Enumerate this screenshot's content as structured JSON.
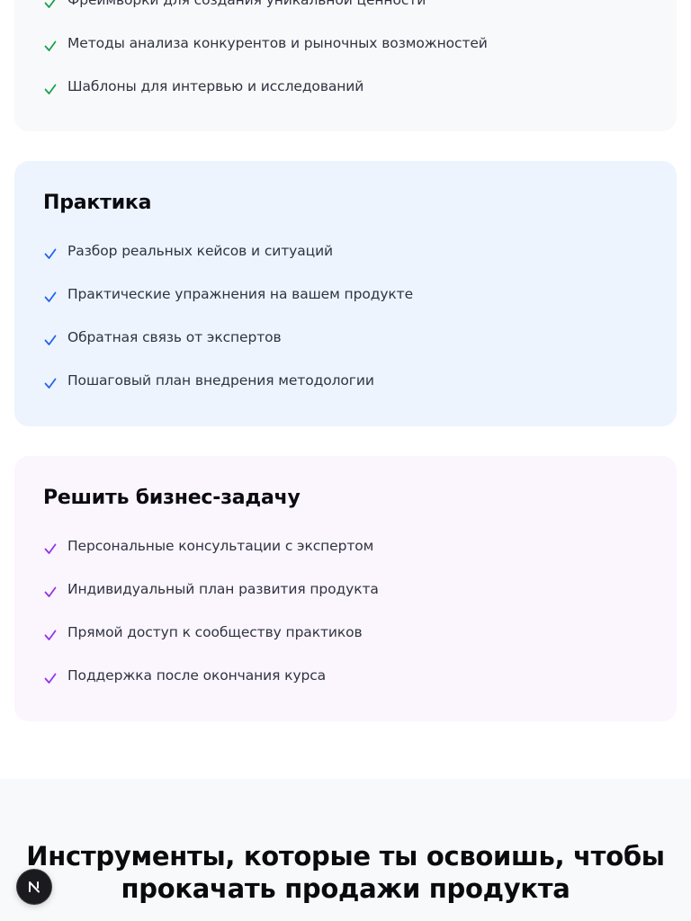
{
  "sections": {
    "top": {
      "items": [
        "Фреймворки для создания уникальной ценности",
        "Методы анализа конкурентов и рыночных возможностей",
        "Шаблоны для интервью и исследований"
      ],
      "check_color": "#16a34a"
    },
    "practice": {
      "title": "Практика",
      "items": [
        "Разбор реальных кейсов и ситуаций",
        "Практические упражнения на вашем продукте",
        "Обратная связь от экспертов",
        "Пошаговый план внедрения методологии"
      ],
      "check_color": "#2563eb"
    },
    "business": {
      "title": "Решить бизнес-задачу",
      "items": [
        "Персональные консультации с экспертом",
        "Индивидуальный план развития продукта",
        "Прямой доступ к сообществу практиков",
        "Поддержка после окончания курса"
      ],
      "check_color": "#9333ea"
    }
  },
  "tools_section": {
    "heading_line1": "Инструменты, которые ты освоишь, чтобы",
    "heading_line2": "прокачать продажи продукта"
  },
  "floating_badge": {
    "label": "N",
    "icon": "next-logo-icon"
  }
}
